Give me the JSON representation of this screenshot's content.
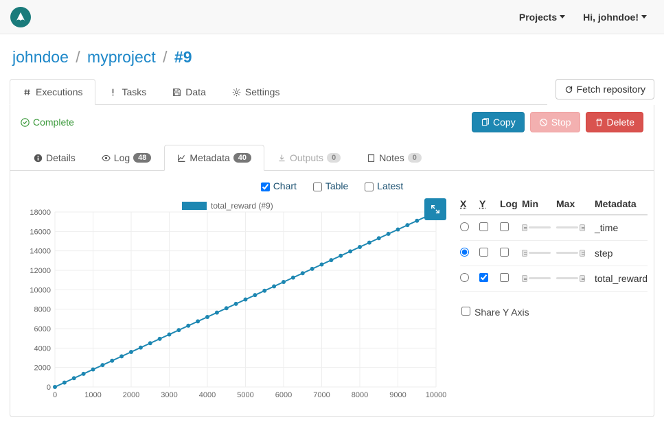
{
  "navbar": {
    "projects_label": "Projects",
    "greeting": "Hi, johndoe!"
  },
  "breadcrumb": {
    "user": "johndoe",
    "project": "myproject",
    "run": "#9"
  },
  "main_tabs": {
    "executions": "Executions",
    "tasks": "Tasks",
    "data": "Data",
    "settings": "Settings"
  },
  "fetch_button": "Fetch repository",
  "status_label": "Complete",
  "actions": {
    "copy": "Copy",
    "stop": "Stop",
    "delete": "Delete"
  },
  "sub_tabs": {
    "details": {
      "label": "Details"
    },
    "log": {
      "label": "Log",
      "badge": "48"
    },
    "metadata": {
      "label": "Metadata",
      "badge": "40"
    },
    "outputs": {
      "label": "Outputs",
      "badge": "0"
    },
    "notes": {
      "label": "Notes",
      "badge": "0"
    }
  },
  "view_controls": {
    "chart": "Chart",
    "table": "Table",
    "latest": "Latest"
  },
  "chart_data": {
    "type": "line",
    "title": "",
    "legend": "total_reward (#9)",
    "xlabel": "",
    "ylabel": "",
    "xlim": [
      0,
      10000
    ],
    "ylim": [
      0,
      18000
    ],
    "x_ticks": [
      0,
      1000,
      2000,
      3000,
      4000,
      5000,
      6000,
      7000,
      8000,
      9000,
      10000
    ],
    "y_ticks": [
      0,
      2000,
      4000,
      6000,
      8000,
      10000,
      12000,
      14000,
      16000,
      18000
    ],
    "x": [
      0,
      250,
      500,
      750,
      1000,
      1250,
      1500,
      1750,
      2000,
      2250,
      2500,
      2750,
      3000,
      3250,
      3500,
      3750,
      4000,
      4250,
      4500,
      4750,
      5000,
      5250,
      5500,
      5750,
      6000,
      6250,
      6500,
      6750,
      7000,
      7250,
      7500,
      7750,
      8000,
      8250,
      8500,
      8750,
      9000,
      9250,
      9500,
      9750
    ],
    "y": [
      0,
      450,
      900,
      1350,
      1800,
      2250,
      2700,
      3150,
      3600,
      4050,
      4500,
      4950,
      5400,
      5850,
      6300,
      6750,
      7200,
      7650,
      8100,
      8550,
      9000,
      9450,
      9900,
      10350,
      10800,
      11250,
      11700,
      12150,
      12600,
      13050,
      13500,
      13950,
      14400,
      14850,
      15300,
      15750,
      16200,
      16650,
      17100,
      17550
    ]
  },
  "controls_table": {
    "headers": {
      "x": "X",
      "y": "Y",
      "log": "Log",
      "min": "Min",
      "max": "Max",
      "meta": "Metadata"
    },
    "rows": [
      {
        "name": "_time",
        "x": false,
        "y": false,
        "log": false
      },
      {
        "name": "step",
        "x": true,
        "y": false,
        "log": false
      },
      {
        "name": "total_reward",
        "x": false,
        "y": true,
        "log": false
      }
    ],
    "share_y": "Share Y Axis"
  }
}
